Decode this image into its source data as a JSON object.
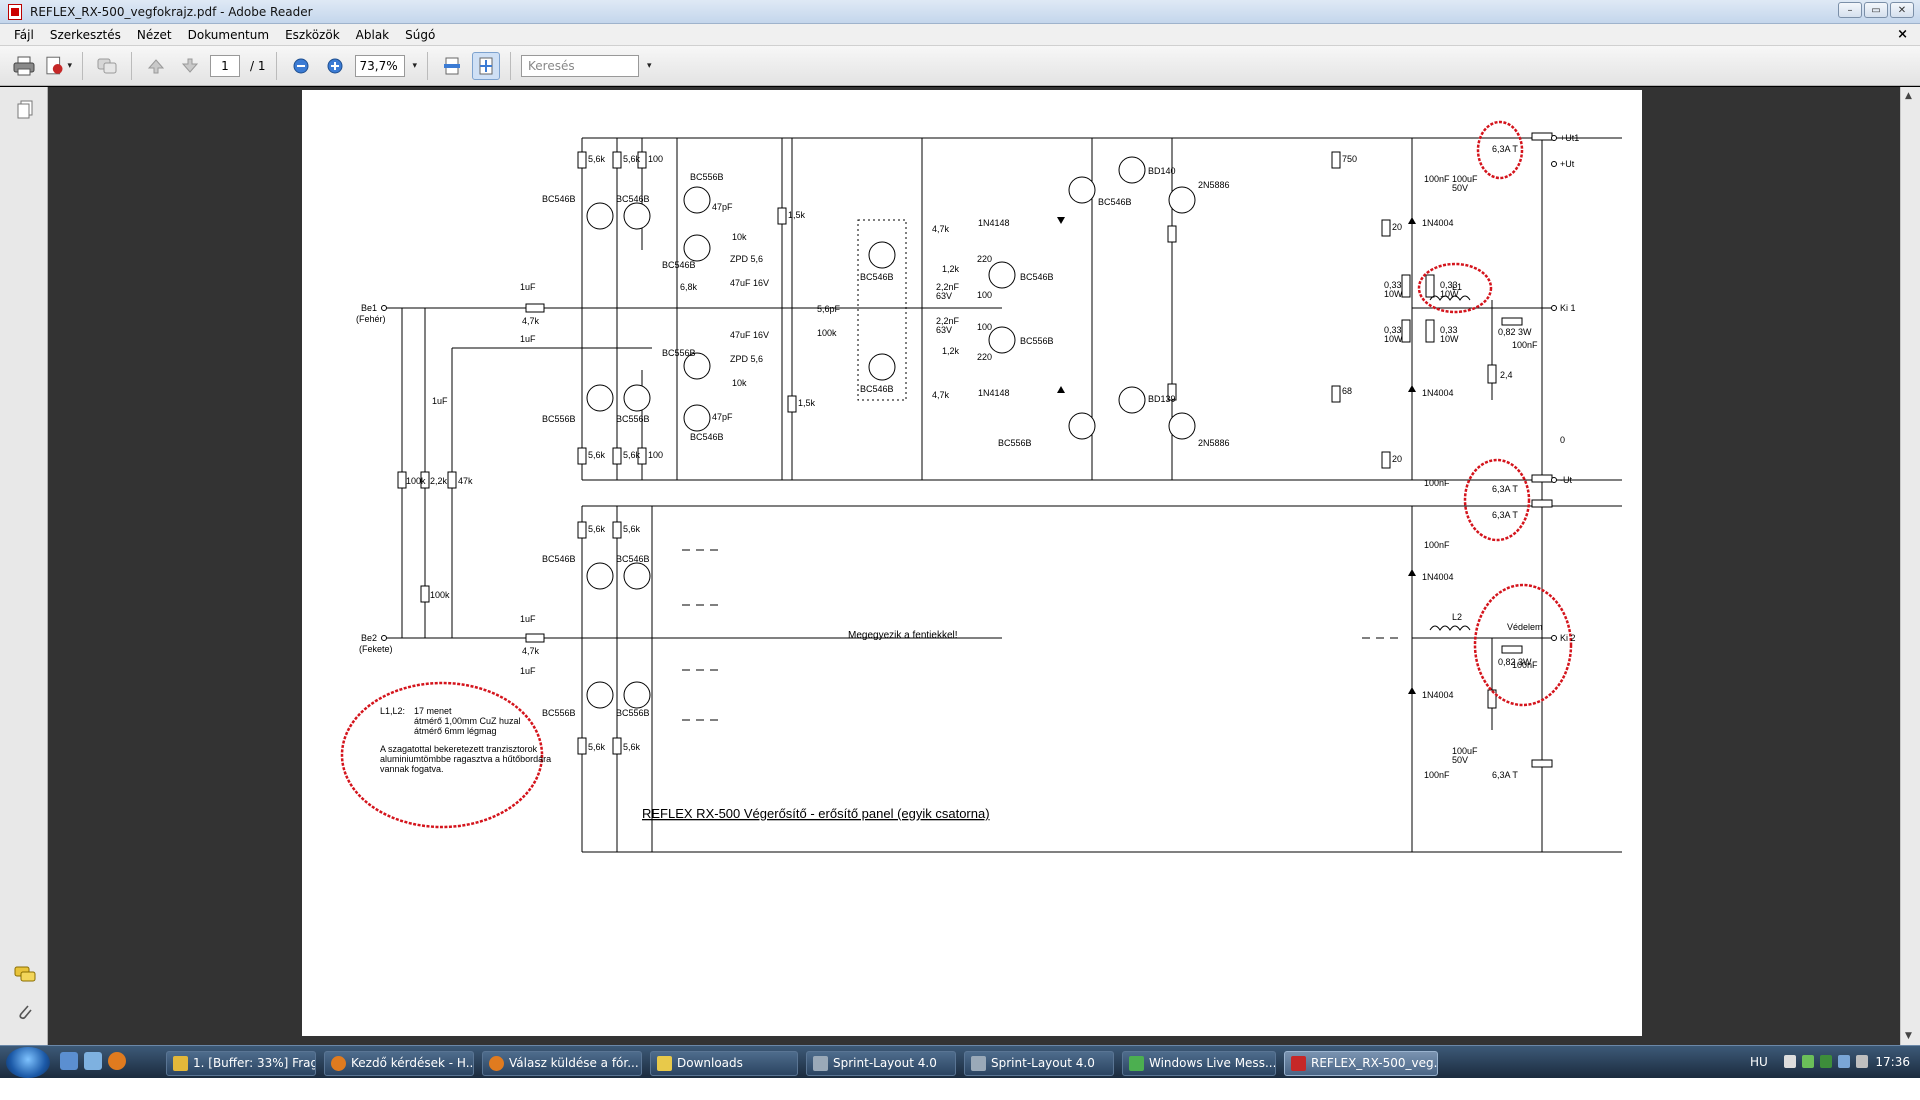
{
  "window": {
    "title": "REFLEX_RX-500_vegfokrajz.pdf - Adobe Reader",
    "buttons": [
      "–",
      "▭",
      "✕"
    ]
  },
  "menu": {
    "items": [
      "Fájl",
      "Szerkesztés",
      "Nézet",
      "Dokumentum",
      "Eszközök",
      "Ablak",
      "Súgó"
    ],
    "close": "×"
  },
  "toolbar": {
    "page_current": "1",
    "page_total": "/ 1",
    "zoom": "73,7%",
    "search_placeholder": "Keresés"
  },
  "schematic": {
    "caption": "REFLEX  RX-500  Végerősítő   -  erősítő panel (egyik csatorna)",
    "inputs": {
      "be1": "Be1",
      "be1_sub": "(Fehér)",
      "be2": "Be2",
      "be2_sub": "(Fekete)"
    },
    "outputs": {
      "ut1": "+Ut1",
      "ut": "+Ut",
      "ki1": "Ki 1",
      "zero": "0",
      "minus_ut": "-Ut",
      "ki2": "Ki 2",
      "vedelem": "Védelem"
    },
    "same_note": "Megegyezik a fentiekkel!",
    "note": {
      "l1l2": "L1,L2:",
      "line1": "17 menet",
      "line2": "átmérő 1,00mm CuZ huzal",
      "line3": "átmérő 6mm légmag",
      "line4": "A szagatottal bekeretezett tranzisztorok",
      "line5": "aluminiumtömbbe ragasztva a hűtőbordára",
      "line6": "vannak fogatva."
    },
    "labels": {
      "r56k": "5,6k",
      "r100": "100",
      "r47k": "4,7k",
      "r15k": "1,5k",
      "r10k": "10k",
      "r68k": "6,8k",
      "r100k": "100k",
      "r22k": "2,2k",
      "r47kb": "47k",
      "r12k": "1,2k",
      "r220": "220",
      "r750": "750",
      "r68": "68",
      "r20": "20",
      "r033": "0,33",
      "w10": "10W",
      "r082": "0,82  3W",
      "r24": "2,4",
      "c1u": "1uF",
      "c47p": "47pF",
      "c56p": "5,6pF",
      "c22n": "2,2nF",
      "v63": "63V",
      "c100n": "100nF",
      "c100u": "100uF",
      "v50": "50V",
      "c47u": "47uF 16V",
      "zpd": "ZPD 5,6",
      "fuse": "6,3A T",
      "l1": "L1",
      "l2": "L2",
      "bc546": "BC546B",
      "bc556": "BC556B",
      "bd140": "BD140",
      "bd139": "BD139",
      "q5886": "2N5886",
      "d4148": "1N4148",
      "d4004": "1N4004"
    }
  },
  "taskbar": {
    "items": [
      "1. [Buffer: 33%] Frag...",
      "Kezdő kérdések - H...",
      "Válasz küldése a fór...",
      "Downloads",
      "Sprint-Layout 4.0",
      "Sprint-Layout 4.0",
      "Windows Live Mess...",
      "REFLEX_RX-500_veg..."
    ],
    "lang": "HU",
    "clock": "17:36"
  },
  "colors": {
    "annotation_red": "#d4141c",
    "taskbar": "#2b4461",
    "doc_bg": "#333333"
  }
}
